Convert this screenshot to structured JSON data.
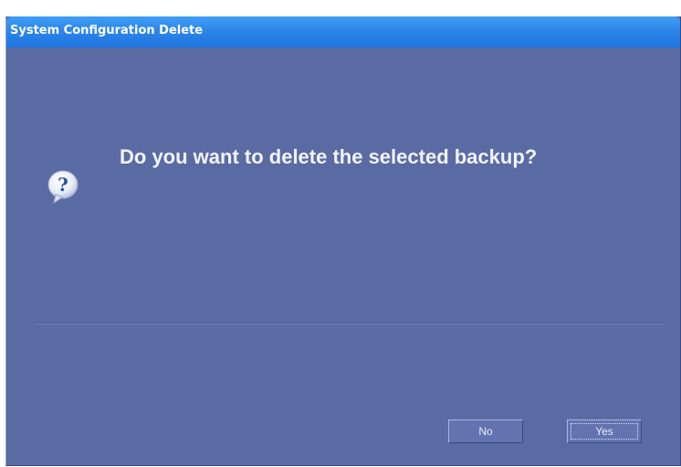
{
  "dialog": {
    "title": "System Configuration Delete",
    "message": "Do you want to delete the selected backup?",
    "icon": "question-icon",
    "buttons": {
      "no_label": "No",
      "yes_label": "Yes",
      "default": "Yes"
    }
  },
  "colors": {
    "title_bar": "#2c86ea",
    "body": "#5a6ba4",
    "text": "#f2f4fb"
  }
}
